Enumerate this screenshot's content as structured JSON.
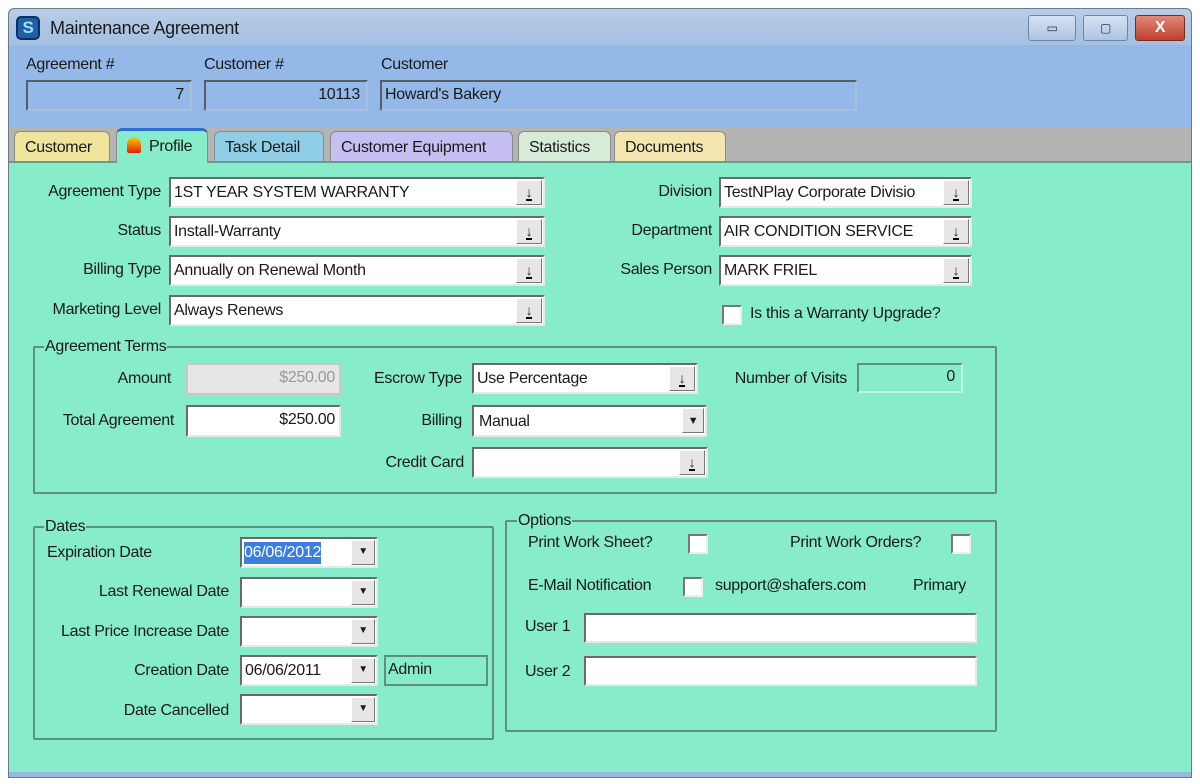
{
  "window": {
    "title": "Maintenance Agreement",
    "minimize": "▭",
    "maximize": "▢",
    "close": "X"
  },
  "header": {
    "agreement_label": "Agreement #",
    "agreement_value": "7",
    "customer_num_label": "Customer #",
    "customer_num_value": "10113",
    "customer_label": "Customer",
    "customer_value": "Howard's Bakery"
  },
  "tabs": [
    "Customer",
    "Profile",
    "Task Detail",
    "Customer Equipment",
    "Statistics",
    "Documents"
  ],
  "active_tab": "Profile",
  "profile": {
    "agreement_type": {
      "label": "Agreement Type",
      "value": "1ST YEAR SYSTEM WARRANTY"
    },
    "status": {
      "label": "Status",
      "value": "Install-Warranty"
    },
    "billing_type": {
      "label": "Billing Type",
      "value": "Annually on Renewal Month"
    },
    "marketing_level": {
      "label": "Marketing Level",
      "value": "Always Renews"
    },
    "division": {
      "label": "Division",
      "value": "TestNPlay Corporate Divisio"
    },
    "department": {
      "label": "Department",
      "value": "AIR CONDITION SERVICE"
    },
    "sales_person": {
      "label": "Sales Person",
      "value": "MARK FRIEL"
    },
    "warranty_upgrade": {
      "label": "Is this a Warranty Upgrade?",
      "checked": false
    }
  },
  "terms": {
    "legend": "Agreement Terms",
    "amount_label": "Amount",
    "amount_value": "$250.00",
    "total_label": "Total Agreement",
    "total_value": "$250.00",
    "escrow_label": "Escrow Type",
    "escrow_value": "Use Percentage",
    "billing_label": "Billing",
    "billing_value": "Manual",
    "credit_label": "Credit Card",
    "credit_value": "",
    "visits_label": "Number of Visits",
    "visits_value": "0"
  },
  "dates": {
    "legend": "Dates",
    "expiration_label": "Expiration Date",
    "expiration_value": "06/06/2012",
    "renewal_label": "Last Renewal Date",
    "renewal_value": "",
    "price_label": "Last Price Increase Date",
    "price_value": "",
    "creation_label": "Creation Date",
    "creation_value": "06/06/2011",
    "creation_user": "Admin",
    "cancelled_label": "Date Cancelled",
    "cancelled_value": ""
  },
  "options": {
    "legend": "Options",
    "work_sheet_label": "Print Work Sheet?",
    "work_orders_label": "Print Work Orders?",
    "email_label": "E-Mail Notification",
    "email_value": "support@shafers.com",
    "email_type": "Primary",
    "user1_label": "User 1",
    "user1_value": "",
    "user2_label": "User 2",
    "user2_value": ""
  }
}
